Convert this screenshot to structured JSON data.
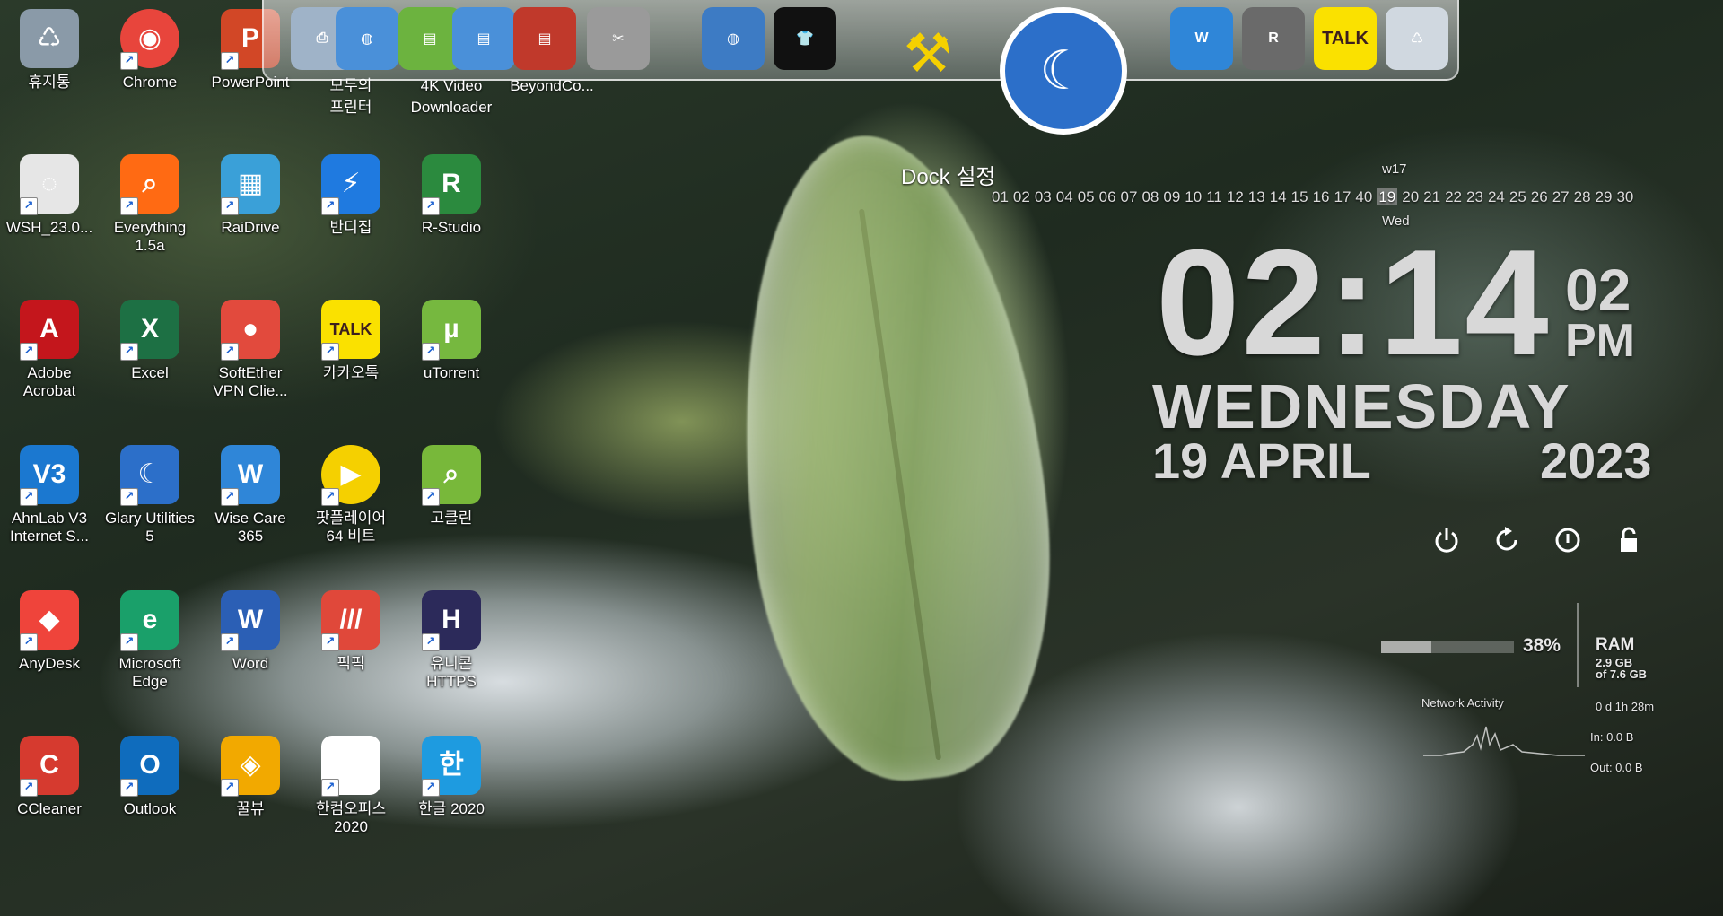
{
  "desktop_icons": [
    {
      "label": "휴지통",
      "icon": "recycle-bin-icon",
      "color": "#8a9aa8"
    },
    {
      "label": "Chrome",
      "icon": "chrome-icon",
      "color": "#e8453c"
    },
    {
      "label": "PowerPoint",
      "icon": "powerpoint-icon",
      "color": "#d24726"
    },
    {
      "label": "모두의\n프린터",
      "icon": "printer-icon",
      "color": "#5a8fd0"
    },
    {
      "label": "4K Video\nDownloader",
      "icon": "video-downloader-icon",
      "color": "#6cb33f"
    },
    {
      "label": "BeyondCo...",
      "icon": "beyond-compare-icon",
      "color": "#c0392b"
    },
    {
      "label": "WSH_23.0...",
      "icon": "disc-icon",
      "color": "#e6e6e6"
    },
    {
      "label": "Everything\n1.5a",
      "icon": "search-magnifier-icon",
      "color": "#ff6a13"
    },
    {
      "label": "RaiDrive",
      "icon": "raidrive-icon",
      "color": "#3aa0d8"
    },
    {
      "label": "반디집",
      "icon": "bandizip-icon",
      "color": "#1f7ae0"
    },
    {
      "label": "R-Studio",
      "icon": "r-studio-icon",
      "color": "#2b8a3e"
    },
    {
      "label": "Adobe\nAcrobat",
      "icon": "acrobat-icon",
      "color": "#c4161c"
    },
    {
      "label": "Excel",
      "icon": "excel-icon",
      "color": "#1d7044"
    },
    {
      "label": "SoftEther\nVPN Clie...",
      "icon": "softether-icon",
      "color": "#e24a3d"
    },
    {
      "label": "카카오톡",
      "icon": "kakaotalk-icon",
      "color": "#fae100"
    },
    {
      "label": "uTorrent",
      "icon": "utorrent-icon",
      "color": "#76b83f"
    },
    {
      "label": "AhnLab V3\nInternet S...",
      "icon": "ahnlab-v3-icon",
      "color": "#1b78d0"
    },
    {
      "label": "Glary Utilities\n5",
      "icon": "glary-icon",
      "color": "#2c6fc9"
    },
    {
      "label": "Wise Care\n365",
      "icon": "wise-care-icon",
      "color": "#2f86d8"
    },
    {
      "label": "팟플레이어\n64 비트",
      "icon": "potplayer-icon",
      "color": "#f5d000"
    },
    {
      "label": "고클린",
      "icon": "goclean-icon",
      "color": "#78b83a"
    },
    {
      "label": "AnyDesk",
      "icon": "anydesk-icon",
      "color": "#ef443b"
    },
    {
      "label": "Microsoft\nEdge",
      "icon": "edge-icon",
      "color": "#1aa06a"
    },
    {
      "label": "Word",
      "icon": "word-icon",
      "color": "#2b5fb5"
    },
    {
      "label": "픽픽",
      "icon": "picpick-icon",
      "color": "#e0483a"
    },
    {
      "label": "유니콘\nHTTPS",
      "icon": "unicorn-https-icon",
      "color": "#2c2a5a"
    },
    {
      "label": "CCleaner",
      "icon": "ccleaner-icon",
      "color": "#d63a2f"
    },
    {
      "label": "Outlook",
      "icon": "outlook-icon",
      "color": "#0f6cbd"
    },
    {
      "label": "꿀뷰",
      "icon": "honeyview-icon",
      "color": "#f2a900"
    },
    {
      "label": "한컴오피스\n2020",
      "icon": "hancom-office-icon",
      "color": "#ffffff"
    },
    {
      "label": "한글 2020",
      "icon": "hangul-icon",
      "color": "#1e9be0"
    }
  ],
  "dock": {
    "items": [
      {
        "icon": "printer-icon"
      },
      {
        "icon": "globe-icon"
      },
      {
        "icon": "folder-icon"
      },
      {
        "icon": "folder-icon"
      },
      {
        "icon": "folder-icon"
      },
      {
        "icon": "tools-icon"
      },
      {
        "icon": "globe-icon"
      },
      {
        "icon": "tshirt-icon"
      },
      {
        "icon": "hammer-icon"
      },
      {
        "icon": "glary-icon"
      },
      {
        "icon": "wise-care-icon"
      },
      {
        "icon": "r-studio-icon"
      },
      {
        "icon": "kakaotalk-icon"
      },
      {
        "icon": "recycle-bin-icon"
      }
    ],
    "settings_label": "Dock 설정",
    "kakao_text": "TALK"
  },
  "calendar": {
    "week_label": "w17",
    "days": [
      "01",
      "02",
      "03",
      "04",
      "05",
      "06",
      "07",
      "08",
      "09",
      "10",
      "11",
      "12",
      "13",
      "14",
      "15",
      "16",
      "17",
      "40",
      "19",
      "20",
      "21",
      "22",
      "23",
      "24",
      "25",
      "26",
      "27",
      "28",
      "29",
      "30"
    ],
    "today": "19",
    "today_label": "Wed"
  },
  "clock": {
    "time": "02:14",
    "seconds": "02",
    "ampm": "PM",
    "weekday": "WEDNESDAY",
    "date": "19 APRIL",
    "year": "2023"
  },
  "system": {
    "ram_percent": "38%",
    "ram_fill": 0.38,
    "ram_label": "RAM",
    "ram_used": "2.9 GB",
    "ram_total": "of 7.6 GB",
    "uptime": "0 d 1h 28m",
    "network_label": "Network Activity",
    "net_in": "In: 0.0 B",
    "net_out": "Out: 0.0 B"
  }
}
